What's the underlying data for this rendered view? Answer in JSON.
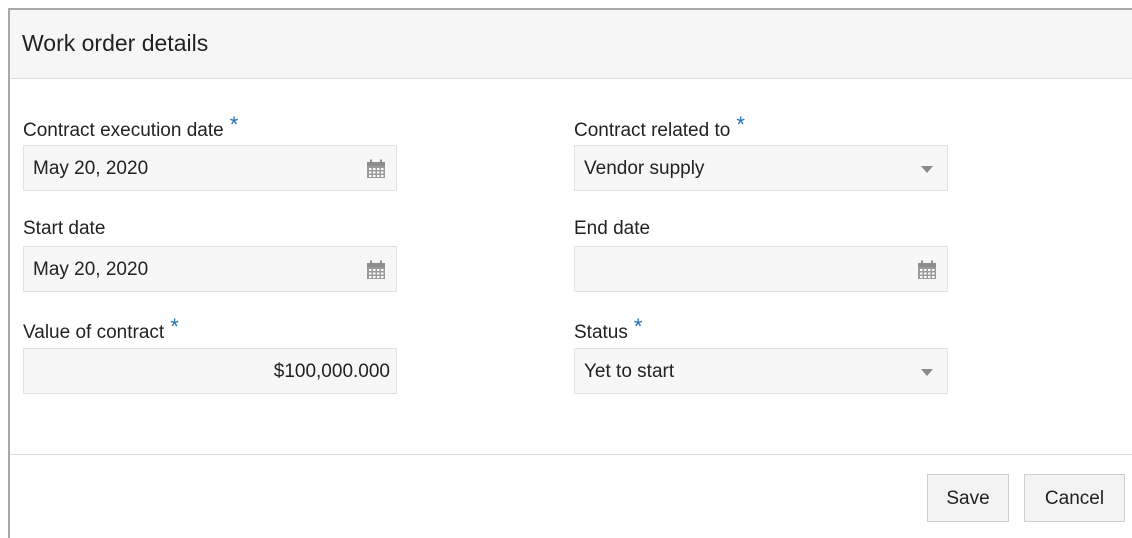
{
  "dialog": {
    "title": "Work order details"
  },
  "form": {
    "contract_execution_date": {
      "label": "Contract execution date",
      "required": "*",
      "value": "May 20, 2020"
    },
    "contract_related_to": {
      "label": "Contract related to",
      "required": "*",
      "value": "Vendor supply"
    },
    "start_date": {
      "label": "Start date",
      "value": "May 20, 2020"
    },
    "end_date": {
      "label": "End date",
      "value": ""
    },
    "value_of_contract": {
      "label": "Value of contract",
      "required": "*",
      "value": "$100,000.000"
    },
    "status": {
      "label": "Status",
      "required": "*",
      "value": "Yet to start"
    }
  },
  "footer": {
    "save_label": "Save",
    "cancel_label": "Cancel"
  },
  "icons": {
    "date_picker": "calendar-icon",
    "dropdown": "chevron-down-icon"
  },
  "colors": {
    "required_marker": "#1f6fb2",
    "header_background": "#f6f6f6",
    "input_background": "#f7f7f7"
  }
}
